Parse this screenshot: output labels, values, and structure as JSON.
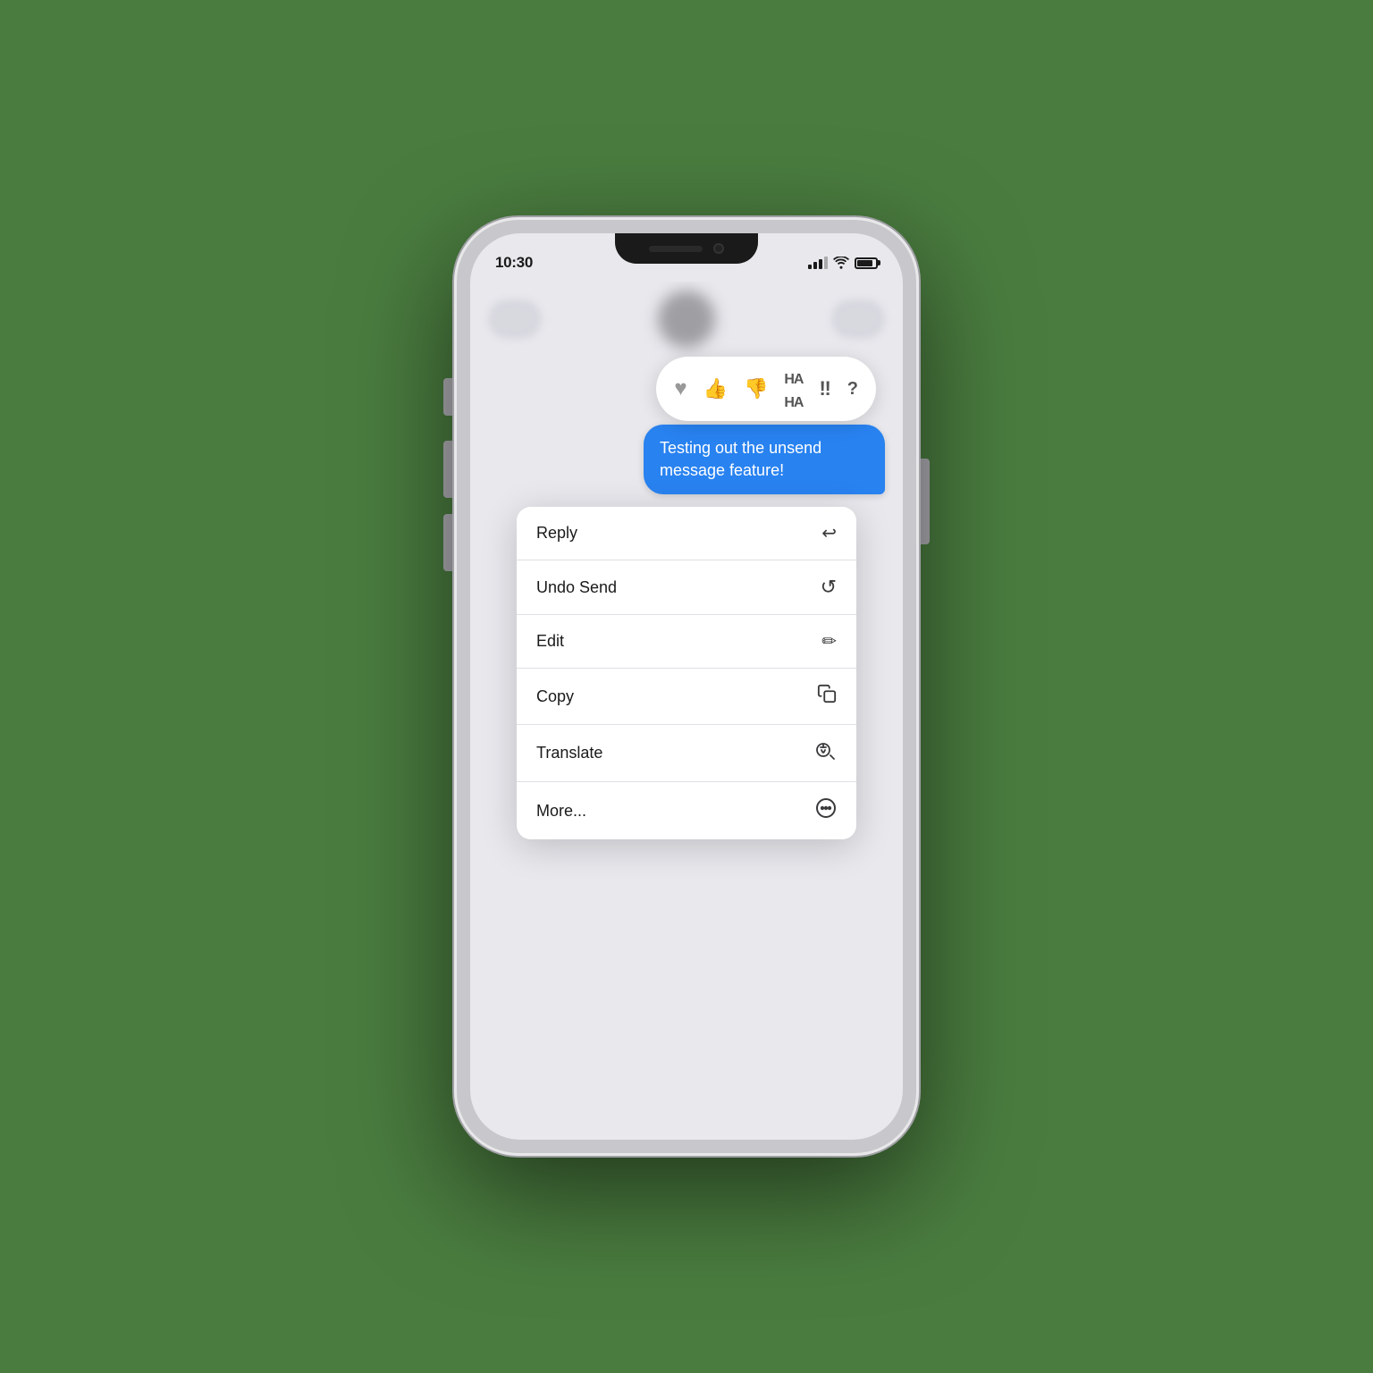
{
  "phone": {
    "status_time": "10:30",
    "screen_bg": "#e8e8ed"
  },
  "message": {
    "text": "Testing out the unsend message feature!"
  },
  "reaction_bar": {
    "items": [
      {
        "id": "heart",
        "symbol": "♥",
        "label": "heart"
      },
      {
        "id": "thumbsup",
        "symbol": "👍",
        "label": "thumbs up"
      },
      {
        "id": "thumbsdown",
        "symbol": "👎",
        "label": "thumbs down"
      },
      {
        "id": "haha",
        "symbol": "HAHA",
        "label": "haha"
      },
      {
        "id": "exclaim",
        "symbol": "‼",
        "label": "exclamation"
      },
      {
        "id": "question",
        "symbol": "?",
        "label": "question"
      }
    ]
  },
  "context_menu": {
    "items": [
      {
        "id": "reply",
        "label": "Reply",
        "icon": "↩"
      },
      {
        "id": "undo-send",
        "label": "Undo Send",
        "icon": "↺"
      },
      {
        "id": "edit",
        "label": "Edit",
        "icon": "✏"
      },
      {
        "id": "copy",
        "label": "Copy",
        "icon": "⧉"
      },
      {
        "id": "translate",
        "label": "Translate",
        "icon": "🅐"
      },
      {
        "id": "more",
        "label": "More...",
        "icon": "···"
      }
    ]
  }
}
